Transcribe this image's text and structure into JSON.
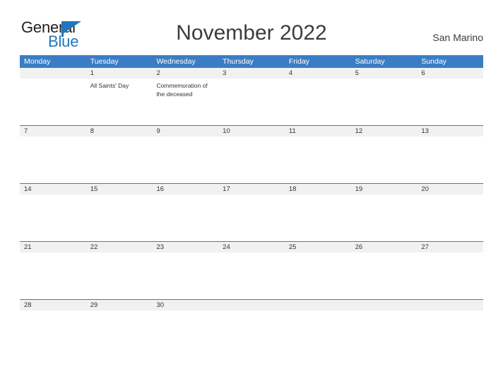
{
  "brand": {
    "word_one": "General",
    "word_two": "Blue",
    "flag_icon": "flag-triangle-icon",
    "color_dark": "#231f20",
    "color_blue": "#1f76bc"
  },
  "header": {
    "title": "November 2022",
    "country": "San Marino"
  },
  "theme": {
    "header_blue": "#3b7dc4",
    "date_band_gray": "#f1f1f1",
    "text_dark": "#333333"
  },
  "calendar": {
    "weekdays": [
      "Monday",
      "Tuesday",
      "Wednesday",
      "Thursday",
      "Friday",
      "Saturday",
      "Sunday"
    ],
    "weeks": [
      {
        "days": [
          {
            "date": "",
            "events": []
          },
          {
            "date": "1",
            "events": [
              "All Saints' Day"
            ]
          },
          {
            "date": "2",
            "events": [
              "Commemoration of the deceased"
            ]
          },
          {
            "date": "3",
            "events": []
          },
          {
            "date": "4",
            "events": []
          },
          {
            "date": "5",
            "events": []
          },
          {
            "date": "6",
            "events": []
          }
        ]
      },
      {
        "days": [
          {
            "date": "7",
            "events": []
          },
          {
            "date": "8",
            "events": []
          },
          {
            "date": "9",
            "events": []
          },
          {
            "date": "10",
            "events": []
          },
          {
            "date": "11",
            "events": []
          },
          {
            "date": "12",
            "events": []
          },
          {
            "date": "13",
            "events": []
          }
        ]
      },
      {
        "days": [
          {
            "date": "14",
            "events": []
          },
          {
            "date": "15",
            "events": []
          },
          {
            "date": "16",
            "events": []
          },
          {
            "date": "17",
            "events": []
          },
          {
            "date": "18",
            "events": []
          },
          {
            "date": "19",
            "events": []
          },
          {
            "date": "20",
            "events": []
          }
        ]
      },
      {
        "days": [
          {
            "date": "21",
            "events": []
          },
          {
            "date": "22",
            "events": []
          },
          {
            "date": "23",
            "events": []
          },
          {
            "date": "24",
            "events": []
          },
          {
            "date": "25",
            "events": []
          },
          {
            "date": "26",
            "events": []
          },
          {
            "date": "27",
            "events": []
          }
        ]
      },
      {
        "days": [
          {
            "date": "28",
            "events": []
          },
          {
            "date": "29",
            "events": []
          },
          {
            "date": "30",
            "events": []
          },
          {
            "date": "",
            "events": []
          },
          {
            "date": "",
            "events": []
          },
          {
            "date": "",
            "events": []
          },
          {
            "date": "",
            "events": []
          }
        ]
      }
    ]
  }
}
